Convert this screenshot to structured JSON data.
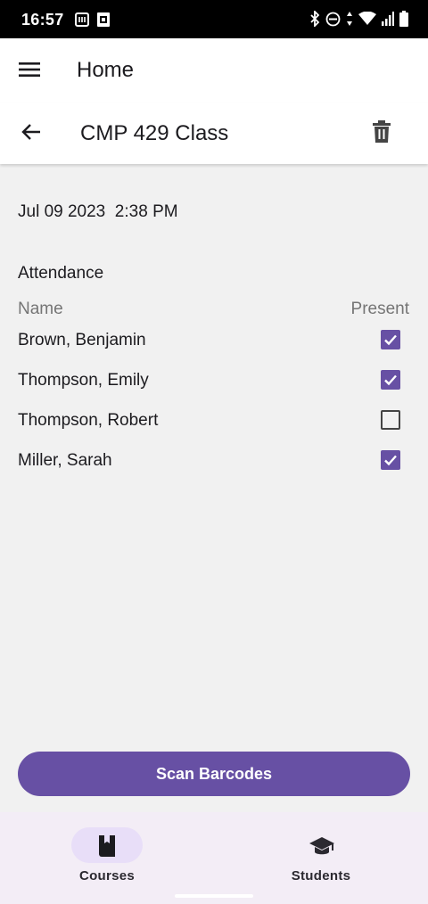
{
  "status_bar": {
    "time": "16:57",
    "icons": [
      "nfc-icon",
      "sim-icon",
      "bluetooth-icon",
      "do-not-disturb-icon",
      "data-arrows-icon",
      "wifi-icon",
      "signal-icon",
      "battery-icon"
    ]
  },
  "app_bar": {
    "title": "Home",
    "menu_icon": "hamburger-menu-icon"
  },
  "sub_bar": {
    "title": "CMP 429 Class",
    "back_icon": "arrow-back-icon",
    "delete_icon": "trash-icon"
  },
  "session": {
    "datetime": "Jul 09 2023  2:38 PM"
  },
  "attendance": {
    "heading": "Attendance",
    "columns": {
      "name": "Name",
      "present": "Present"
    },
    "rows": [
      {
        "name": "Brown, Benjamin",
        "present": true
      },
      {
        "name": "Thompson, Emily",
        "present": true
      },
      {
        "name": "Thompson, Robert",
        "present": false
      },
      {
        "name": "Miller, Sarah",
        "present": true
      }
    ]
  },
  "actions": {
    "scan_label": "Scan Barcodes"
  },
  "bottom_nav": {
    "items": [
      {
        "label": "Courses",
        "icon": "book-icon",
        "active": true
      },
      {
        "label": "Students",
        "icon": "graduation-cap-icon",
        "active": false
      }
    ]
  },
  "colors": {
    "accent": "#6750a4",
    "nav_background": "#f3edf6",
    "active_pill": "#e8def8"
  }
}
